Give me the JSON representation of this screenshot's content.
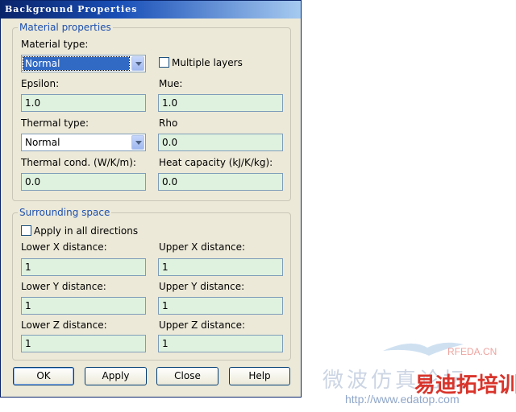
{
  "window": {
    "title": "Background Properties"
  },
  "material": {
    "legend": "Material properties",
    "material_type_label": "Material type:",
    "material_type_value": "Normal",
    "multiple_layers_label": "Multiple layers",
    "multiple_layers_checked": false,
    "epsilon_label": "Epsilon:",
    "epsilon_value": "1.0",
    "mue_label": "Mue:",
    "mue_value": "1.0",
    "thermal_type_label": "Thermal type:",
    "thermal_type_value": "Normal",
    "rho_label": "Rho",
    "rho_value": "0.0",
    "thermal_cond_label": "Thermal cond. (W/K/m):",
    "thermal_cond_value": "0.0",
    "heat_capacity_label": "Heat capacity (kJ/K/kg):",
    "heat_capacity_value": "0.0"
  },
  "surrounding": {
    "legend": "Surrounding space",
    "apply_all_label": "Apply in all directions",
    "apply_all_checked": false,
    "lower_x_label": "Lower X distance:",
    "lower_x_value": "1",
    "upper_x_label": "Upper X distance:",
    "upper_x_value": "1",
    "lower_y_label": "Lower Y distance:",
    "lower_y_value": "1",
    "upper_y_label": "Upper Y distance:",
    "upper_y_value": "1",
    "lower_z_label": "Lower Z distance:",
    "lower_z_value": "1",
    "upper_z_label": "Upper Z distance:",
    "upper_z_value": "1"
  },
  "buttons": {
    "ok": "OK",
    "apply": "Apply",
    "close": "Close",
    "help": "Help"
  },
  "watermark": {
    "line1": "RFEDA.CN",
    "line2": "易迪拓培训",
    "line3": "微波仿真论坛",
    "url": "http://www.edatop.com"
  },
  "colors": {
    "accent": "#1c4fb0",
    "field_bg": "#dff2df",
    "dialog_bg": "#ece9d8",
    "watermark_red": "#d9342b"
  }
}
